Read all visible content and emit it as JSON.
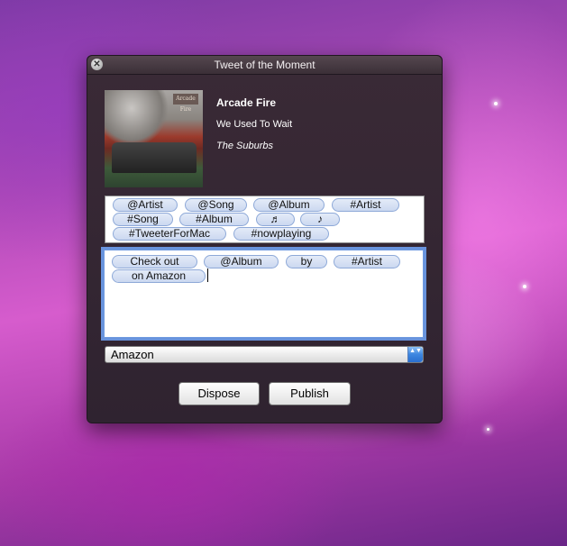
{
  "window": {
    "title": "Tweet of the Moment",
    "close_icon": "close-icon"
  },
  "track": {
    "artist": "Arcade Fire",
    "song": "We Used To Wait",
    "album": "The Suburbs",
    "art_sign": "Arcade Fire"
  },
  "tokens": {
    "artist_handle": "@Artist",
    "song_handle": "@Song",
    "album_handle": "@Album",
    "artist_tag": "#Artist",
    "song_tag": "#Song",
    "album_tag": "#Album",
    "beamed_notes": "♬",
    "eighth_note": "♪",
    "tweeter_tag": "#TweeterForMac",
    "nowplaying_tag": "#nowplaying"
  },
  "compose": {
    "check_out": "Check out",
    "album": "@Album",
    "by": "by",
    "artist": "#Artist",
    "on_amazon": "on Amazon"
  },
  "store_select": {
    "selected": "Amazon",
    "arrows": "▲▼"
  },
  "buttons": {
    "dispose": "Dispose",
    "publish": "Publish"
  }
}
